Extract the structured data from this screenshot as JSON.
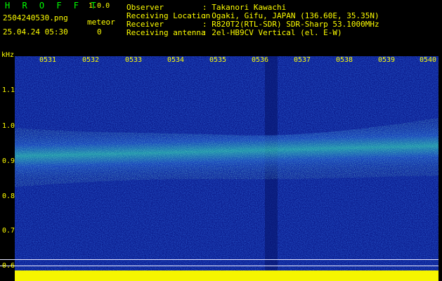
{
  "header": {
    "app_title": "H R O F F T",
    "version": "1.0.0",
    "filename": "2504240530.png",
    "datetime": "25.04.24 05:30",
    "meteor_label": "meteor",
    "meteor_count": "0"
  },
  "info": [
    {
      "key": "Observer",
      "value": ": Takanori Kawachi"
    },
    {
      "key": "Receiving Location",
      "value": ": Ogaki, Gifu, JAPAN (136.60E, 35.35N)"
    },
    {
      "key": "Receiver",
      "value": ": R820T2(RTL-SDR) SDR-Sharp 53.1000MHz"
    },
    {
      "key": "Receiving antenna",
      "value": ": 2el-HB9CV Vertical (el. E-W)"
    }
  ],
  "spectrogram": {
    "unit": "kHz",
    "y_ticks": [
      "1.1",
      "1.0",
      "0.9",
      "0.8",
      "0.7",
      "0.6"
    ],
    "x_ticks": [
      "0531",
      "0532",
      "0533",
      "0534",
      "0535",
      "0536",
      "0537",
      "0538",
      "0539",
      "0540"
    ],
    "colors": {
      "background": "#000000",
      "label": "#ffff00",
      "title": "#00ff00",
      "noise_dark": "#0a1a8c",
      "noise_mid": "#1a3bc8",
      "signal": "#22c7c0",
      "peak": "#5cf08a",
      "power_bar": "#f6f500"
    }
  }
}
